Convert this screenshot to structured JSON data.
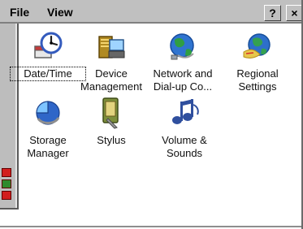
{
  "window": {
    "menus": [
      "File",
      "View"
    ],
    "help_label": "?",
    "close_label": "×"
  },
  "items": [
    {
      "label": "Date/Time",
      "icon": "date-time-icon"
    },
    {
      "label": "Device\nManagement",
      "icon": "device-management-icon"
    },
    {
      "label": "Network and\nDial-up Co...",
      "icon": "network-dialup-icon"
    },
    {
      "label": "Regional\nSettings",
      "icon": "regional-settings-icon"
    },
    {
      "label": "Storage\nManager",
      "icon": "storage-manager-icon"
    },
    {
      "label": "Stylus",
      "icon": "stylus-icon"
    },
    {
      "label": "Volume &\nSounds",
      "icon": "volume-sounds-icon"
    }
  ],
  "colors": {
    "background": "#ffffff",
    "frame": "#c0c0c0",
    "status_red": "#d21e1e",
    "status_green": "#2d8a2d"
  }
}
